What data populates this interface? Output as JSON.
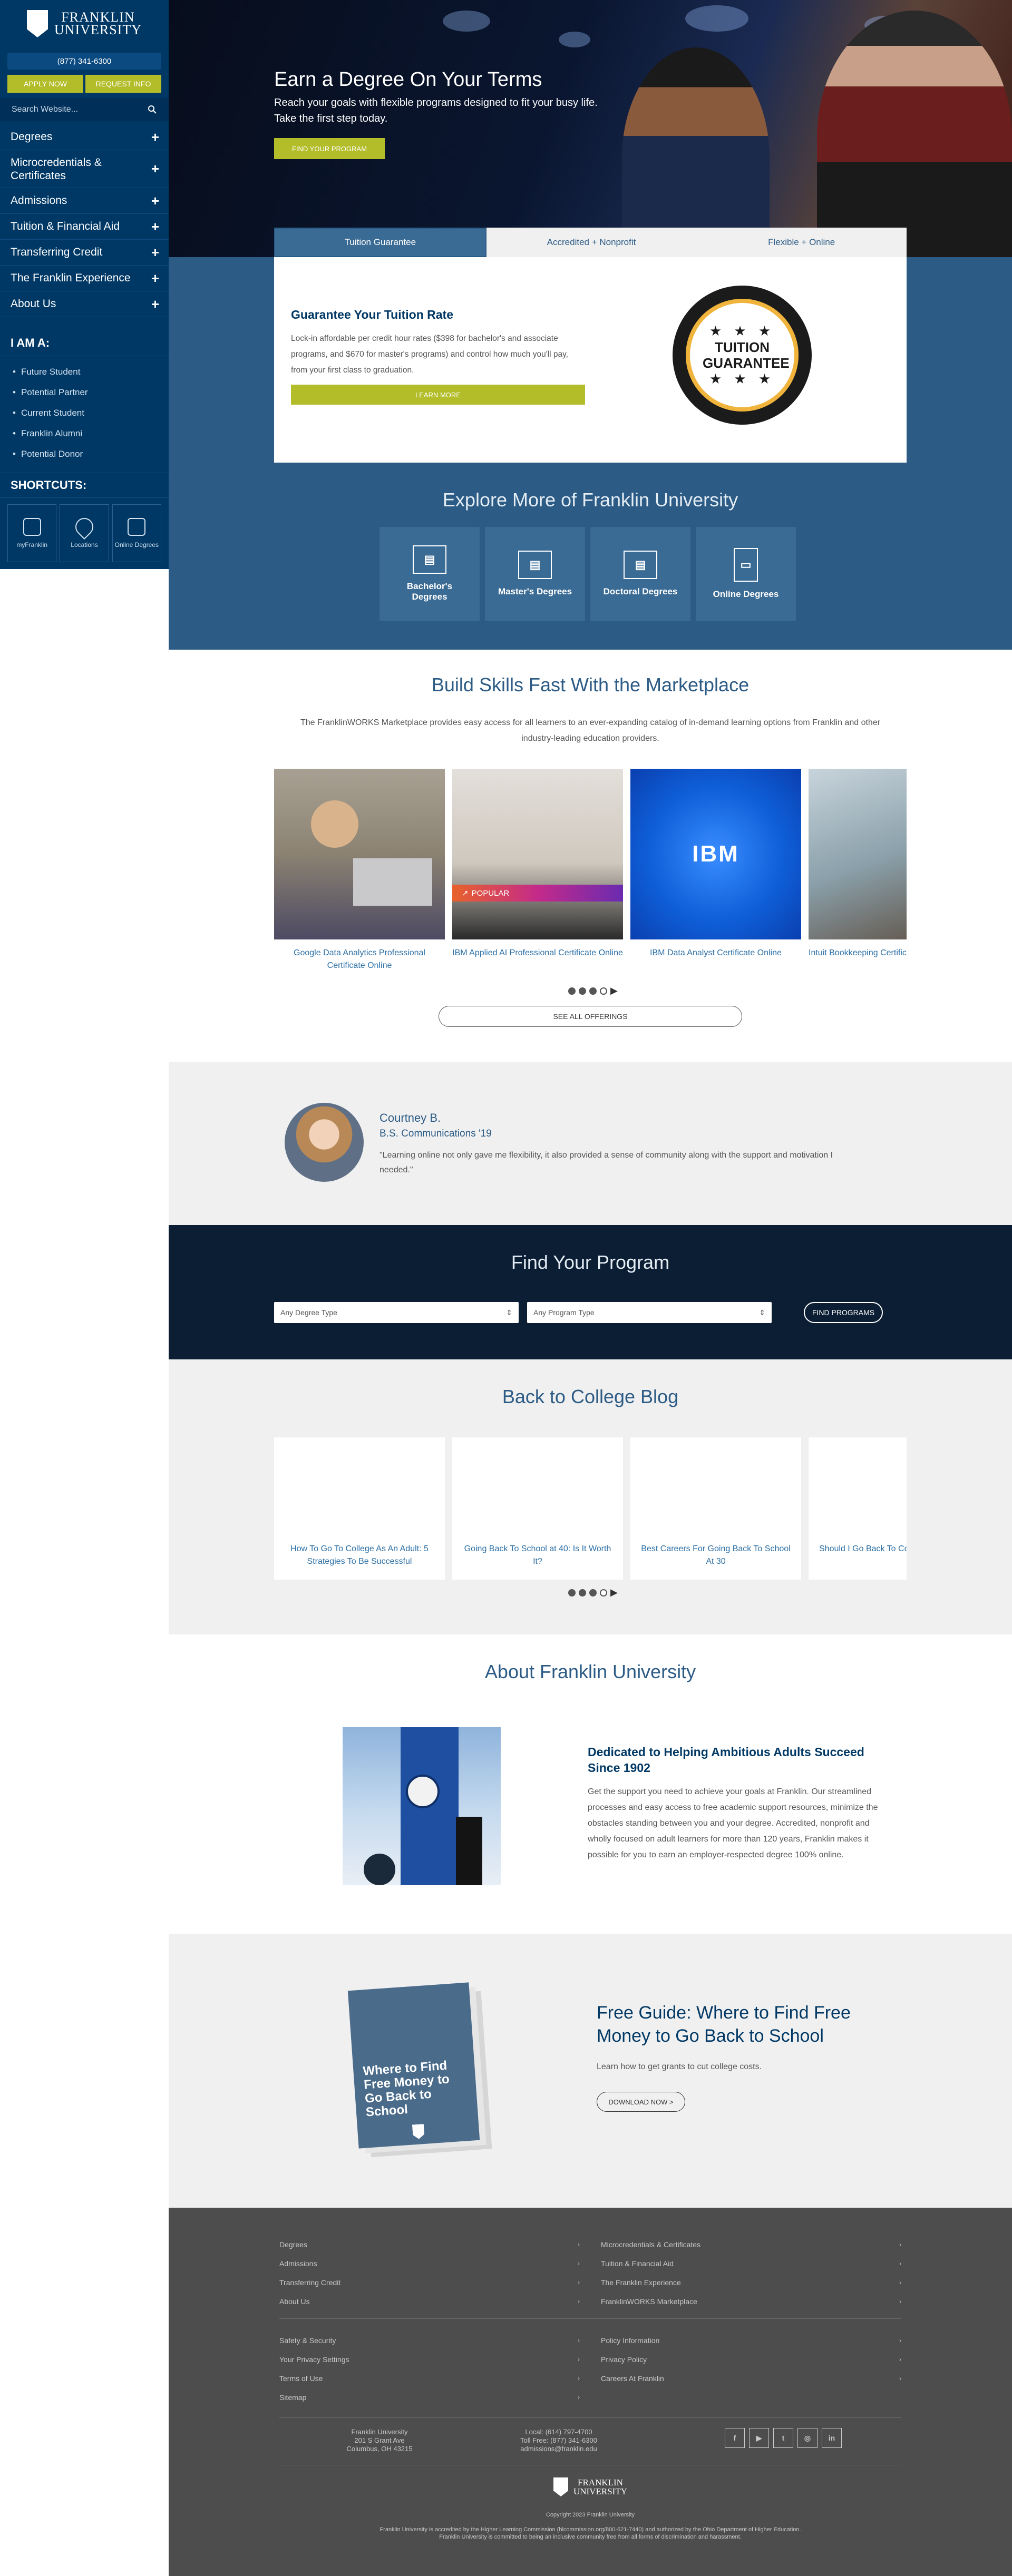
{
  "sidebar": {
    "logo_line1": "FRANKLIN",
    "logo_line2": "UNIVERSITY",
    "phone": "(877) 341-6300",
    "apply_label": "Apply Now",
    "request_label": "Request Info",
    "search_placeholder": "Search Website...",
    "nav": [
      "Degrees",
      "Microcredentials & Certificates",
      "Admissions",
      "Tuition & Financial Aid",
      "Transferring Credit",
      "The Franklin Experience",
      "About Us"
    ],
    "iama_title": "I AM A:",
    "iama": [
      "Future Student",
      "Potential Partner",
      "Current Student",
      "Franklin Alumni",
      "Potential Donor"
    ],
    "shortcuts_title": "SHORTCUTS:",
    "shortcuts": [
      "myFranklin",
      "Locations",
      "Online Degrees"
    ]
  },
  "hero": {
    "title": "Earn a Degree On Your Terms",
    "subtitle": "Reach your goals with flexible programs designed to fit your busy life. Take the first step today.",
    "button": "Find Your Program"
  },
  "tabs": [
    "Tuition Guarantee",
    "Accredited + Nonprofit",
    "Flexible + Online"
  ],
  "guarantee": {
    "title": "Guarantee Your Tuition Rate",
    "body": "Lock-in affordable per credit hour rates ($398 for bachelor's and associate programs, and $670 for master's programs) and control how much you'll pay, from your first class to graduation.",
    "button": "Learn More",
    "badge_text": "TUITION GUARANTEE",
    "badge_stars": "★ ★ ★"
  },
  "explore": {
    "title": "Explore More of Franklin University",
    "cards": [
      "Bachelor's Degrees",
      "Master's Degrees",
      "Doctoral Degrees",
      "Online Degrees"
    ]
  },
  "marketplace": {
    "title": "Build Skills Fast With the Marketplace",
    "description": "The FranklinWORKS Marketplace provides easy access for all learners to an ever-expanding catalog of in-demand learning options from Franklin and other industry-leading education providers.",
    "items": [
      "Google Data Analytics Professional Certificate Online",
      "IBM Applied AI Professional Certificate Online",
      "IBM Data Analyst Certificate Online",
      "Intuit Bookkeeping Certificate"
    ],
    "popular_label": "POPULAR",
    "ibm_logo": "IBM",
    "see_all": "See All Offerings"
  },
  "testimonial": {
    "name": "Courtney B.",
    "degree": "B.S. Communications '19",
    "quote": "\"Learning online not only gave me flexibility, it also provided a sense of community along with the support and motivation I needed.\""
  },
  "find_program": {
    "title": "Find Your Program",
    "degree_placeholder": "Any Degree Type",
    "program_placeholder": "Any Program Type",
    "button": "Find Programs"
  },
  "blog": {
    "title": "Back to College Blog",
    "items": [
      "How To Go To College As An Adult: 5 Strategies To Be Successful",
      "Going Back To School at 40: Is It Worth It?",
      "Best Careers For Going Back To School At 30",
      "Should I Go Back To College? Find the Answer Here"
    ]
  },
  "about": {
    "title": "About Franklin University",
    "heading": "Dedicated to Helping Ambitious Adults Succeed Since 1902",
    "body": "Get the support you need to achieve your goals at Franklin. Our streamlined processes and easy access to free academic support resources, minimize the obstacles standing between you and your degree. Accredited, nonprofit and wholly focused on adult learners for more than 120 years, Franklin makes it possible for you to earn an employer-respected degree 100% online."
  },
  "guide": {
    "book_title": "Where to Find Free Money to Go Back to School",
    "title": "Free Guide: Where to Find Free Money to Go Back to School",
    "subtitle": "Learn how to get grants to cut college costs.",
    "button": "Download Now >"
  },
  "footer": {
    "col1": [
      "Degrees",
      "Admissions",
      "Transferring Credit",
      "About Us"
    ],
    "col2": [
      "Microcredentials & Certificates",
      "Tuition & Financial Aid",
      "The Franklin Experience",
      "FranklinWORKS Marketplace"
    ],
    "col3": [
      "Safety & Security",
      "Your Privacy Settings",
      "Terms of Use",
      "Sitemap"
    ],
    "col4": [
      "Policy Information",
      "Privacy Policy",
      "Careers At Franklin"
    ],
    "addr1": "Franklin University",
    "addr2": "201 S Grant Ave",
    "addr3": "Columbus, OH 43215",
    "contact1": "Local: (614) 797-4700",
    "contact2": "Toll Free: (877) 341-6300",
    "contact3": "admissions@franklin.edu",
    "social": [
      "f",
      "▶",
      "t",
      "◎",
      "in"
    ],
    "copyright": "Copyright 2023 Franklin University",
    "accred1": "Franklin University is accredited by the Higher Learning Commission (hlcommission.org/800-621-7440) and authorized by the Ohio Department of Higher Education.",
    "accred2": "Franklin University is committed to being an inclusive community free from all forms of discrimination and harassment."
  }
}
